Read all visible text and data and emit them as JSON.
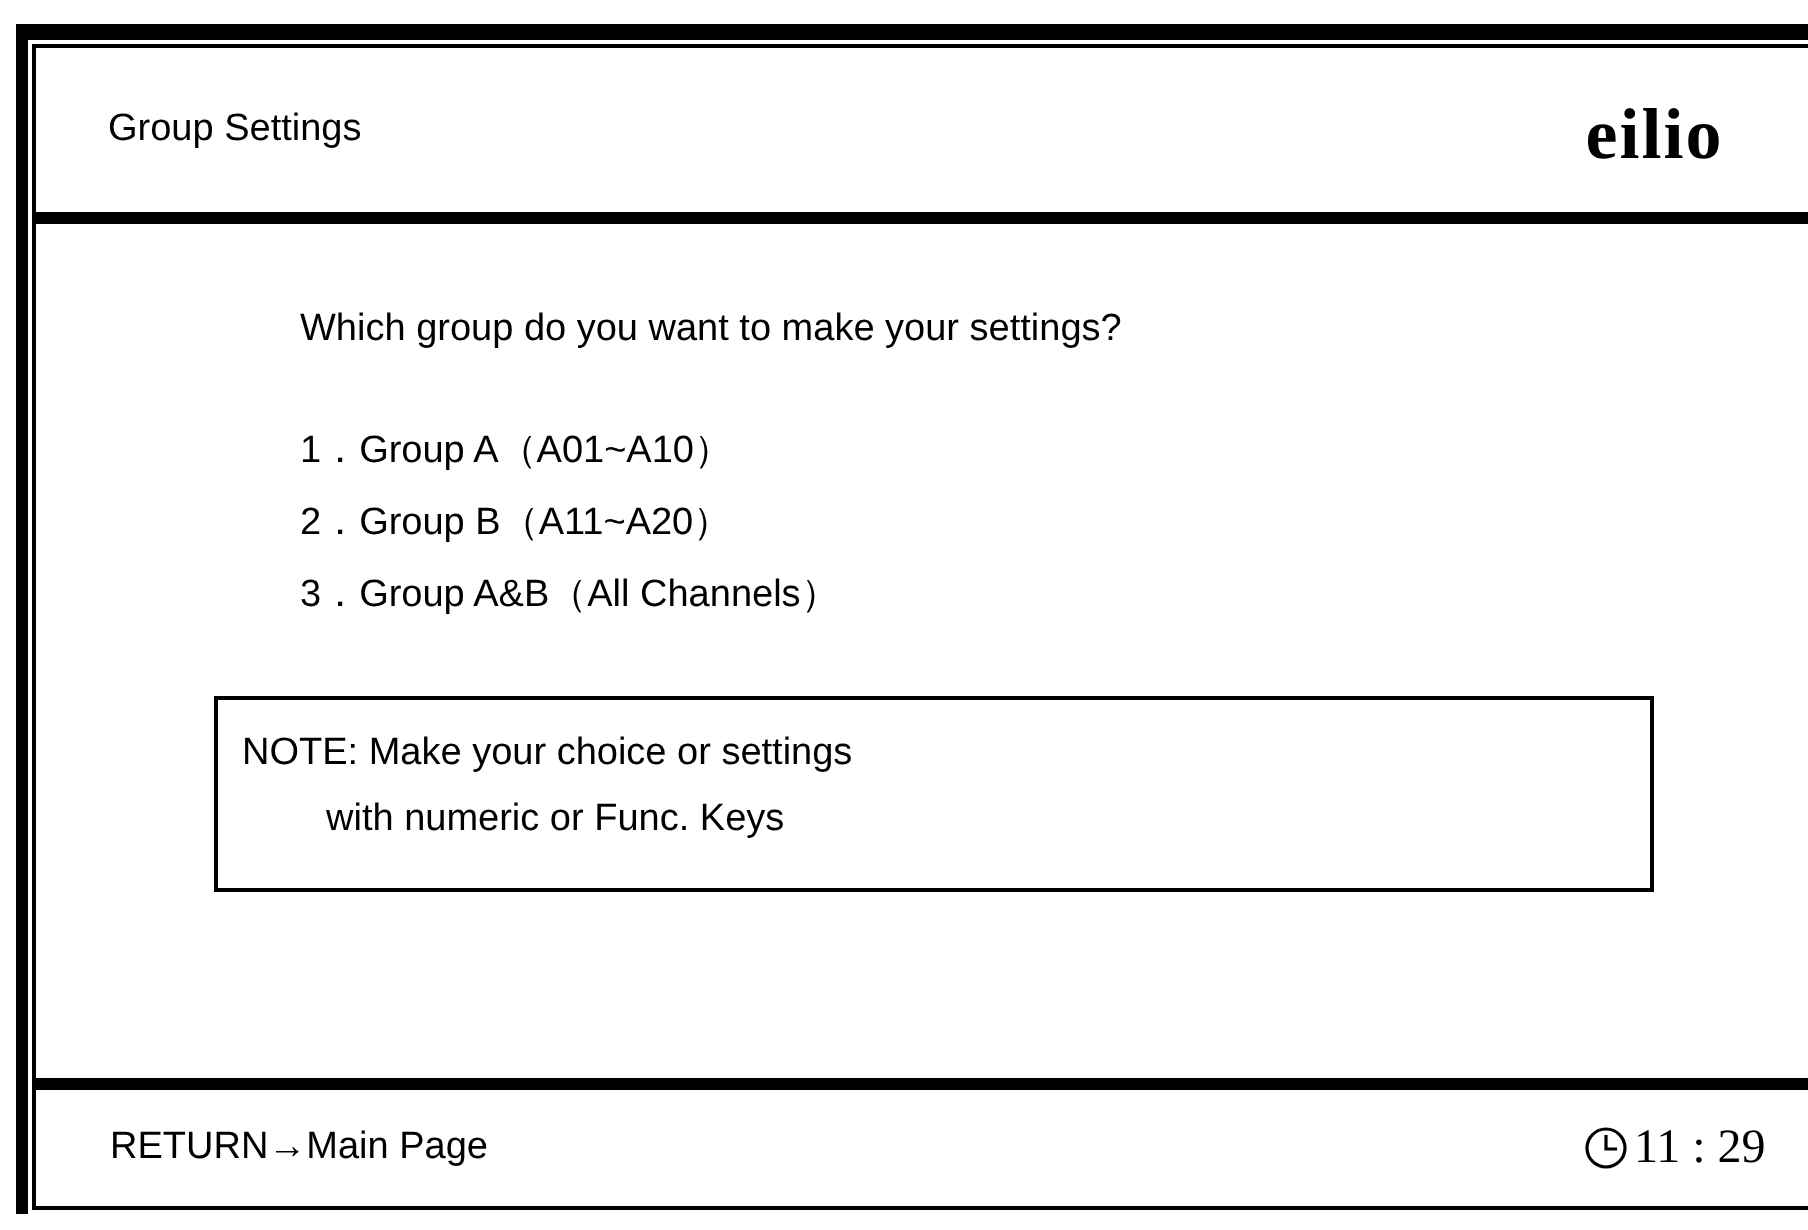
{
  "header": {
    "title": "Group Settings",
    "logo": "eilio"
  },
  "question": "Which group do you want to make your settings?",
  "options": [
    {
      "label": "1．Group A（A01~A10）"
    },
    {
      "label": "2．Group B（A11~A20）"
    },
    {
      "label": "3．Group A&B（All Channels）"
    }
  ],
  "note": {
    "lines": [
      "NOTE: Make your choice or settings",
      "with numeric or Func. Keys"
    ]
  },
  "footer": {
    "return_link": "RETURN→Main Page",
    "time": "11 : 29"
  }
}
